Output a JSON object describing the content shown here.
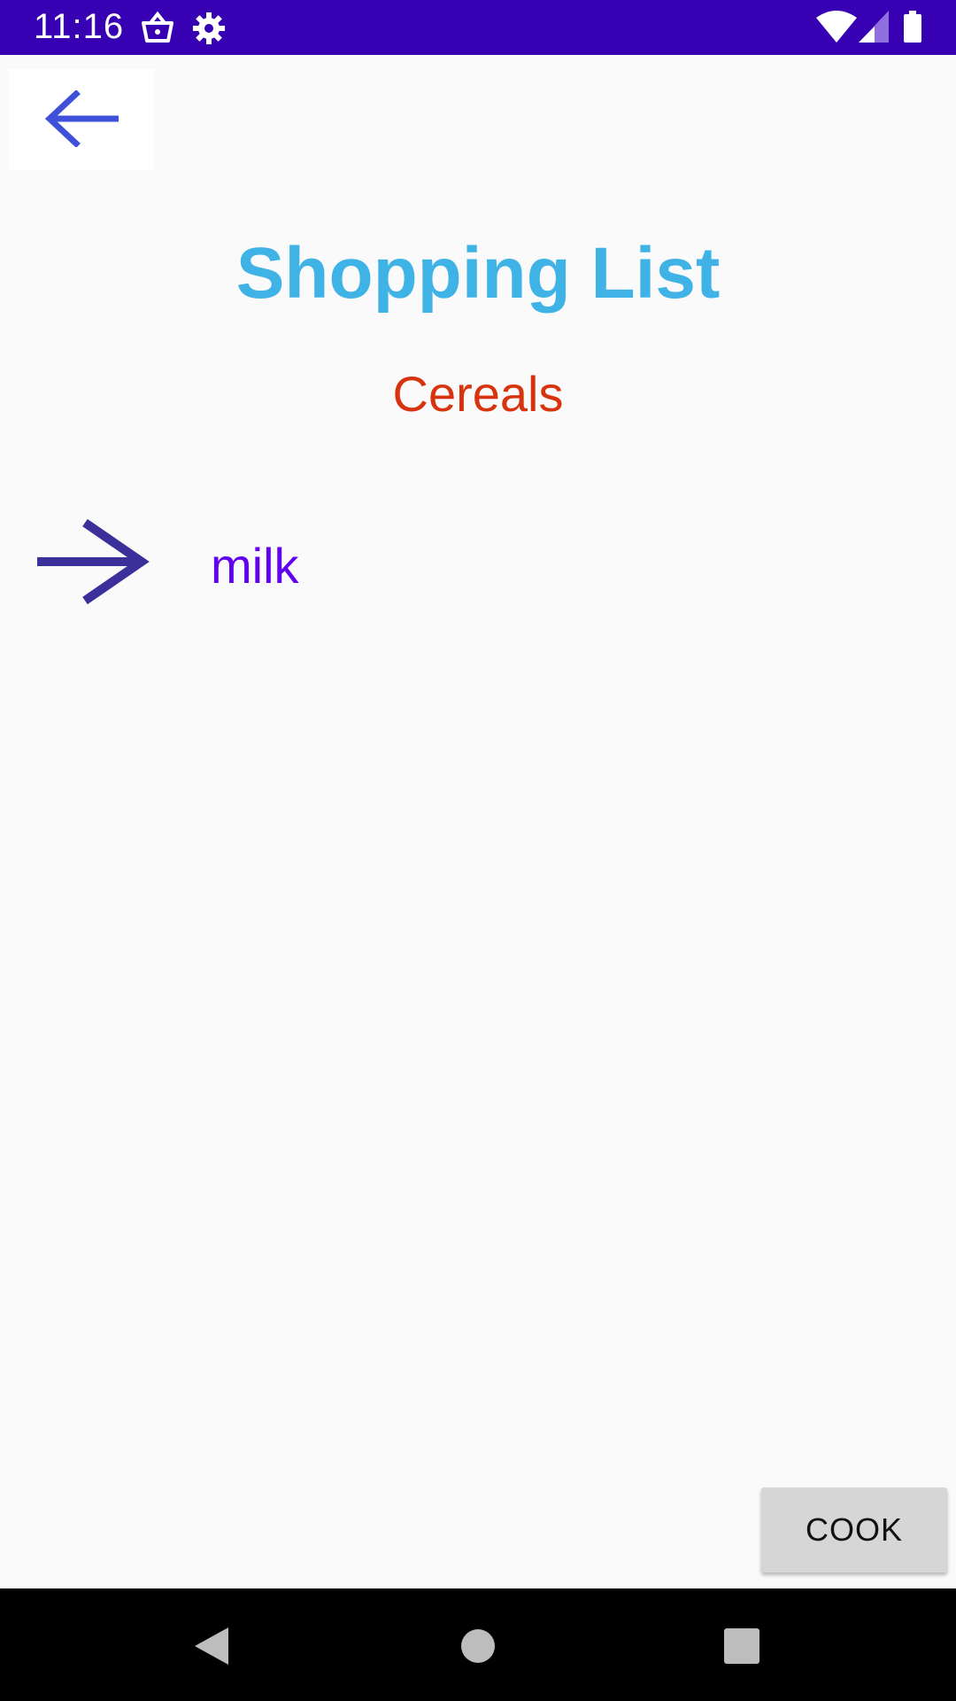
{
  "status_bar": {
    "time": "11:16",
    "left_icons": [
      "shopping-basket-icon",
      "settings-gear-icon"
    ],
    "right_icons": [
      "wifi-icon",
      "signal-icon",
      "battery-icon"
    ],
    "background_color": "#3700b3"
  },
  "toolbar": {
    "back_icon": "arrow-left-icon"
  },
  "page": {
    "title": "Shopping List",
    "category": "Cereals",
    "title_color": "#3fb3e6",
    "category_color": "#d8330f"
  },
  "items": [
    {
      "label": "milk",
      "icon": "arrow-right-icon"
    }
  ],
  "actions": {
    "cook_label": "COOK"
  },
  "nav_bar": {
    "buttons": [
      "back-triangle-icon",
      "home-circle-icon",
      "recents-square-icon"
    ]
  }
}
